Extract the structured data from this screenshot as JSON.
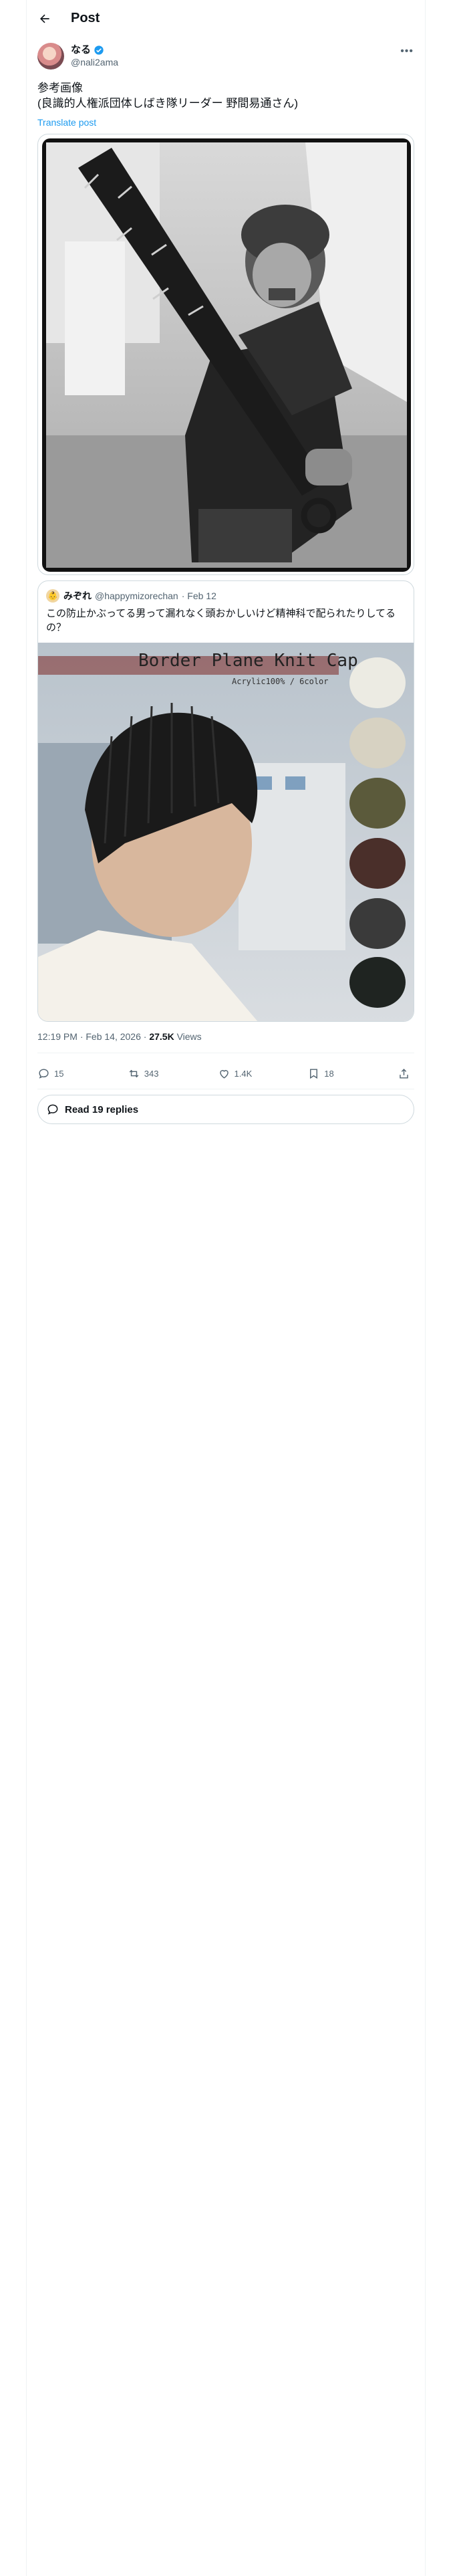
{
  "header": {
    "title": "Post"
  },
  "author": {
    "name": "なる",
    "handle": "@nali2ama"
  },
  "tweet": {
    "text": "参考画像\n(良識的人権派団体しばき隊リーダー 野間易通さん)",
    "translate_label": "Translate post"
  },
  "quote": {
    "name": "みぞれ",
    "handle": "@happymizorechan",
    "date": "· Feb 12",
    "text": "この防止かぶってる男って漏れなく頭おかしいけど精神科で配られたりしてるの？",
    "product_title": "Border Plane Knit Cap",
    "product_subtitle": "Acrylic100% / 6color"
  },
  "meta": {
    "time": "12:19 PM · Feb 14, 2026 · ",
    "views_count": "27.5K",
    "views_label": " Views"
  },
  "actions": {
    "replies": "15",
    "reposts": "343",
    "likes": "1.4K",
    "bookmarks": "18"
  },
  "read_replies_label": "Read 19 replies",
  "colors": {
    "accent": "#1d9bf0",
    "muted": "#536471",
    "border": "#cfd9de"
  }
}
